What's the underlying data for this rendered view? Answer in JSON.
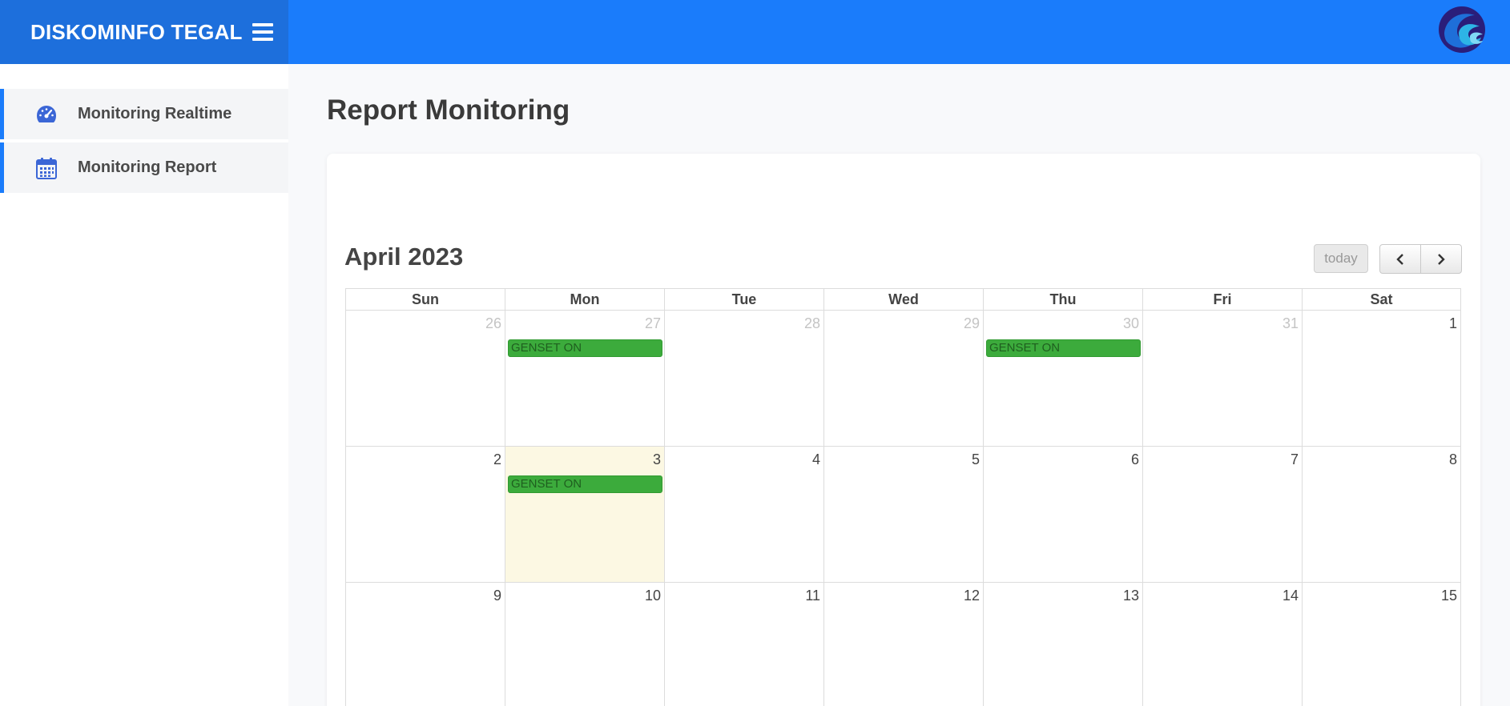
{
  "header": {
    "brand": "DISKOMINFO TEGAL",
    "menu_icon": "hamburger-menu-icon",
    "logo_icon": "kominfo-logo",
    "brand_color": "#1d6fdc",
    "bar_color": "#1a7cfb"
  },
  "sidebar": {
    "items": [
      {
        "label": "Monitoring Realtime",
        "icon": "speedometer-icon"
      },
      {
        "label": "Monitoring Report",
        "icon": "calendar-icon"
      }
    ]
  },
  "main": {
    "title": "Report Monitoring"
  },
  "calendar": {
    "title": "April 2023",
    "today_label": "today",
    "prev_icon": "chevron-left-icon",
    "next_icon": "chevron-right-icon",
    "weekdays": [
      "Sun",
      "Mon",
      "Tue",
      "Wed",
      "Thu",
      "Fri",
      "Sat"
    ],
    "weeks": [
      {
        "days": [
          {
            "num": "26",
            "other": true
          },
          {
            "num": "27",
            "other": true,
            "event": "GENSET ON"
          },
          {
            "num": "28",
            "other": true
          },
          {
            "num": "29",
            "other": true
          },
          {
            "num": "30",
            "other": true,
            "event": "GENSET ON"
          },
          {
            "num": "31",
            "other": true
          },
          {
            "num": "1"
          }
        ]
      },
      {
        "days": [
          {
            "num": "2"
          },
          {
            "num": "3",
            "today": true,
            "event": "GENSET ON"
          },
          {
            "num": "4"
          },
          {
            "num": "5"
          },
          {
            "num": "6"
          },
          {
            "num": "7"
          },
          {
            "num": "8"
          }
        ]
      },
      {
        "days": [
          {
            "num": "9"
          },
          {
            "num": "10"
          },
          {
            "num": "11"
          },
          {
            "num": "12"
          },
          {
            "num": "13"
          },
          {
            "num": "14"
          },
          {
            "num": "15"
          }
        ]
      }
    ],
    "event_color": "#3cab3c",
    "today_color": "#fcf8e3"
  }
}
